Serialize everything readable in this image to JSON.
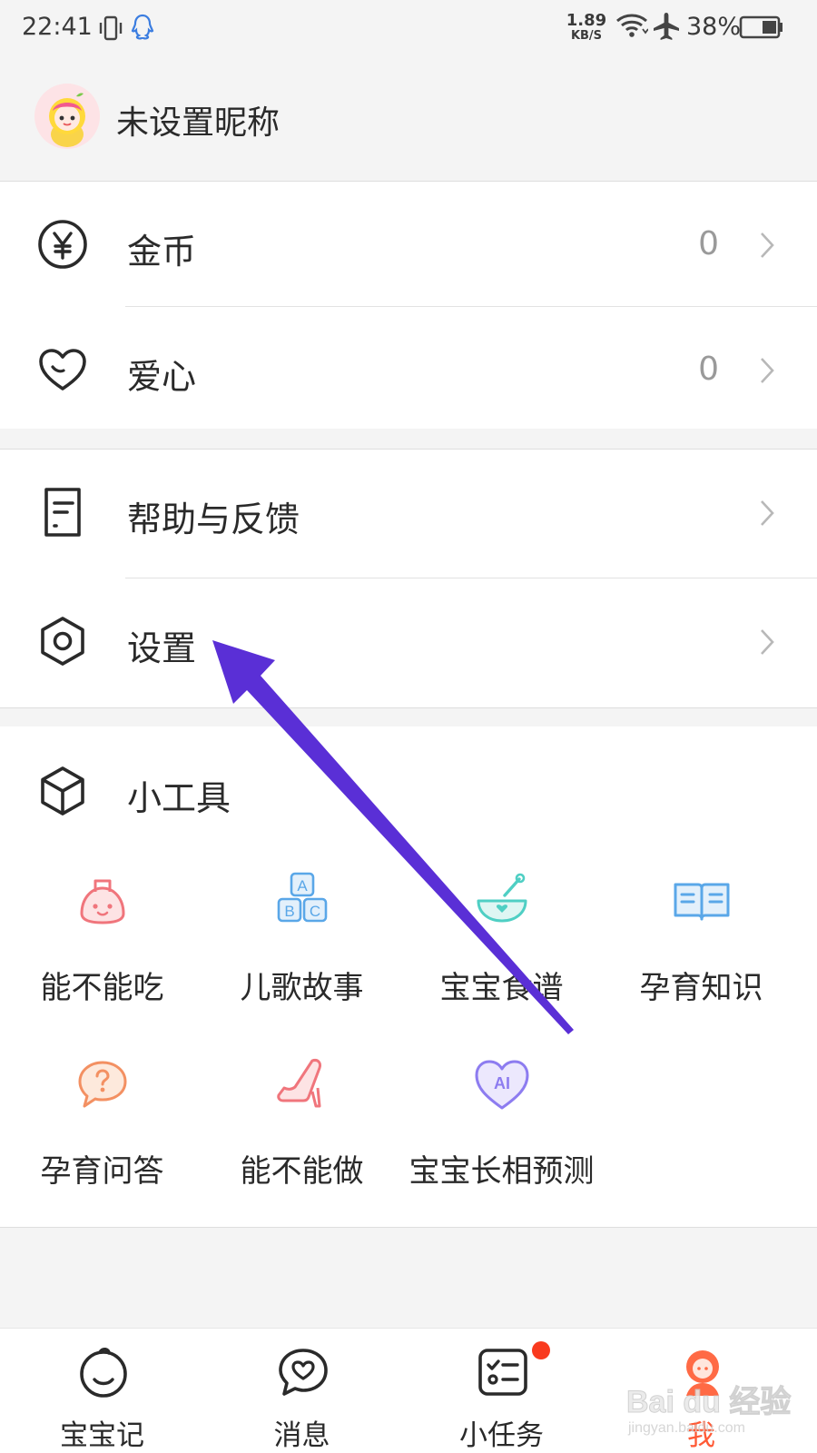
{
  "status_bar": {
    "time": "22:41",
    "net_speed_value": "1.89",
    "net_speed_unit": "KB/S",
    "battery": "38%",
    "icons": [
      "vibrate-icon",
      "qq-icon",
      "wifi-icon",
      "airplane-icon",
      "battery-icon"
    ]
  },
  "profile": {
    "nickname": "未设置昵称"
  },
  "account": [
    {
      "label": "金币",
      "value": "0",
      "icon": "yuan-coin-icon"
    },
    {
      "label": "爱心",
      "value": "0",
      "icon": "heart-icon"
    }
  ],
  "menu": [
    {
      "label": "帮助与反馈",
      "icon": "document-icon"
    },
    {
      "label": "设置",
      "icon": "settings-hexagon-icon"
    }
  ],
  "tools": {
    "title": "小工具",
    "items": [
      {
        "label": "能不能吃",
        "icon": "baby-food-icon",
        "color": "#f0757c"
      },
      {
        "label": "儿歌故事",
        "icon": "abc-blocks-icon",
        "color": "#5aa7e8"
      },
      {
        "label": "宝宝食谱",
        "icon": "bowl-icon",
        "color": "#4fcfc4"
      },
      {
        "label": "孕育知识",
        "icon": "book-icon",
        "color": "#5aa7e8"
      },
      {
        "label": "孕育问答",
        "icon": "question-bubble-icon",
        "color": "#f39062"
      },
      {
        "label": "能不能做",
        "icon": "high-heel-icon",
        "color": "#f0757c"
      },
      {
        "label": "宝宝长相预测",
        "icon": "ai-heart-icon",
        "color": "#8d7cf0"
      }
    ]
  },
  "tabbar": [
    {
      "label": "宝宝记",
      "icon": "baby-face-icon"
    },
    {
      "label": "消息",
      "icon": "message-heart-icon"
    },
    {
      "label": "小任务",
      "icon": "task-list-icon",
      "badge": true
    },
    {
      "label": "我",
      "icon": "profile-icon",
      "active": true
    }
  ],
  "watermark": {
    "text": "Bai du 经验",
    "sub": "jingyan.baidu.com"
  },
  "colors": {
    "accent": "#ff5a36",
    "annotation_arrow": "#5a2fd6",
    "background": "#f4f4f4"
  }
}
